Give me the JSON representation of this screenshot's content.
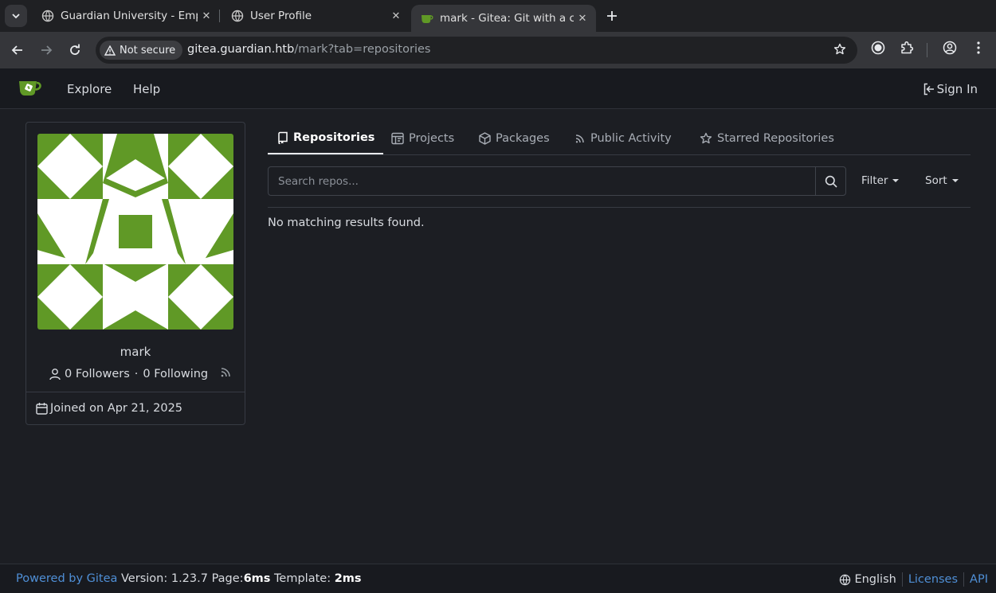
{
  "browser": {
    "tabs": [
      {
        "title": "Guardian University - Emp",
        "active": false
      },
      {
        "title": "User Profile",
        "active": false
      },
      {
        "title": "mark - Gitea: Git with a cu",
        "active": true
      }
    ],
    "security_chip": "Not secure",
    "url_host": "gitea.guardian.htb",
    "url_path": "/mark?tab=repositories"
  },
  "header": {
    "explore": "Explore",
    "help": "Help",
    "sign_in": "Sign In"
  },
  "profile": {
    "username": "mark",
    "followers_text": "0 Followers",
    "separator": "·",
    "following_text": "0 Following",
    "joined": "Joined on Apr 21, 2025"
  },
  "tabs": {
    "repositories": "Repositories",
    "projects": "Projects",
    "packages": "Packages",
    "public_activity": "Public Activity",
    "starred": "Starred Repositories"
  },
  "search": {
    "placeholder": "Search repos...",
    "value": "",
    "filter": "Filter",
    "sort": "Sort"
  },
  "results": {
    "empty_message": "No matching results found."
  },
  "footer": {
    "powered_by": "Powered by Gitea",
    "version_label": "Version:",
    "version": "1.23.7",
    "page_label": "Page:",
    "page_time": "6ms",
    "template_label": "Template:",
    "template_time": "2ms",
    "language": "English",
    "licenses": "Licenses",
    "api": "API"
  },
  "colors": {
    "accent_green": "#609926",
    "link_blue": "#4f8fd6",
    "background": "#1c1e23"
  }
}
